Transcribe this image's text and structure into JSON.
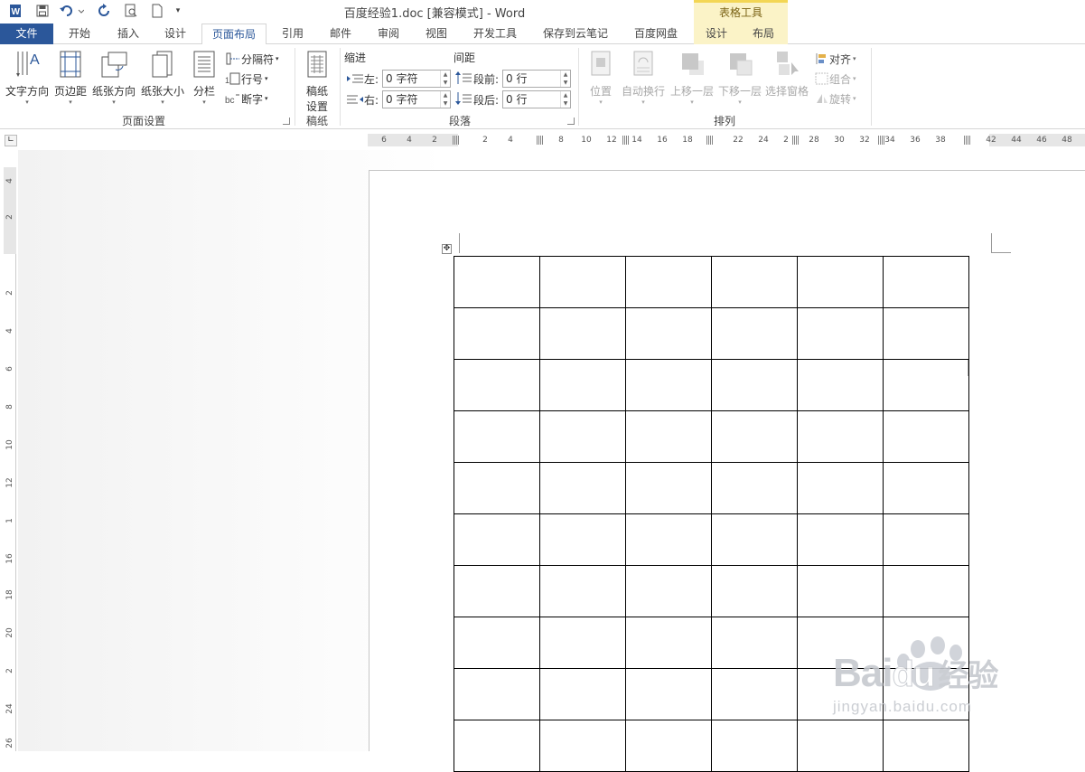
{
  "window": {
    "title": "百度经验1.doc [兼容模式] - Word",
    "context_tab_group": "表格工具"
  },
  "tabs": [
    {
      "label": "文件",
      "type": "file"
    },
    {
      "label": "开始"
    },
    {
      "label": "插入"
    },
    {
      "label": "设计"
    },
    {
      "label": "页面布局",
      "active": true
    },
    {
      "label": "引用"
    },
    {
      "label": "邮件"
    },
    {
      "label": "审阅"
    },
    {
      "label": "视图"
    },
    {
      "label": "开发工具"
    },
    {
      "label": "保存到云笔记"
    },
    {
      "label": "百度网盘"
    },
    {
      "label": "设计",
      "context": true
    },
    {
      "label": "布局",
      "context": true
    }
  ],
  "ribbon": {
    "page_setup": {
      "group_label": "页面设置",
      "text_direction": "文字方向",
      "margins": "页边距",
      "orientation": "纸张方向",
      "size": "纸张大小",
      "columns": "分栏",
      "breaks": "分隔符",
      "line_numbers": "行号",
      "hyphenation": "断字"
    },
    "manuscript": {
      "group_label": "稿纸",
      "button_line1": "稿纸",
      "button_line2": "设置"
    },
    "paragraph": {
      "group_label": "段落",
      "indent_header": "缩进",
      "spacing_header": "间距",
      "indent_left_label": "左:",
      "indent_left_value": "0 字符",
      "indent_right_label": "右:",
      "indent_right_value": "0 字符",
      "spacing_before_label": "段前:",
      "spacing_before_value": "0 行",
      "spacing_after_label": "段后:",
      "spacing_after_value": "0 行"
    },
    "arrange": {
      "group_label": "排列",
      "position": "位置",
      "wrap_text": "自动换行",
      "bring_forward": "上移一层",
      "send_backward": "下移一层",
      "selection_pane": "选择窗格",
      "align": "对齐",
      "group": "组合",
      "rotate": "旋转"
    }
  },
  "h_ruler": {
    "labels": [
      "6",
      "4",
      "2",
      "2",
      "4",
      "8",
      "10",
      "12",
      "14",
      "16",
      "18",
      "22",
      "24",
      "2",
      "28",
      "30",
      "32",
      "34",
      "36",
      "38",
      "42",
      "44",
      "46",
      "48"
    ]
  },
  "v_ruler": {
    "labels": [
      "4",
      "2",
      "2",
      "4",
      "6",
      "8",
      "10",
      "12",
      "1",
      "16",
      "18",
      "20",
      "2",
      "24",
      "26"
    ]
  },
  "table": {
    "rows": 10,
    "cols": 6
  },
  "watermark": {
    "brand": "Bai",
    "brand2": "du",
    "tag": "经验",
    "url": "jingyan.baidu.com"
  },
  "colors": {
    "file_tab": "#2b579a",
    "accent": "#2b579a",
    "context_tab": "#fbf3c7"
  }
}
